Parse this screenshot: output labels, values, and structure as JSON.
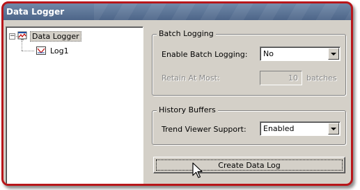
{
  "window": {
    "title": "Data Logger"
  },
  "tree": {
    "root": {
      "label": "Data Logger",
      "expander": "−",
      "icon": "data-logger-icon"
    },
    "children": [
      {
        "label": "Log1",
        "icon": "log-icon"
      }
    ]
  },
  "batch_logging": {
    "title": "Batch Logging",
    "enable_label": "Enable Batch Logging:",
    "enable_value": "No",
    "retain_label": "Retain At Most:",
    "retain_value": "10",
    "retain_unit": "batches"
  },
  "history_buffers": {
    "title": "History Buffers",
    "trend_label": "Trend Viewer Support:",
    "trend_value": "Enabled"
  },
  "actions": {
    "create_label": "Create Data Log"
  },
  "colors": {
    "frame": "#b8161a",
    "titlebar": "#5a7294",
    "face": "#d4d0c8"
  }
}
